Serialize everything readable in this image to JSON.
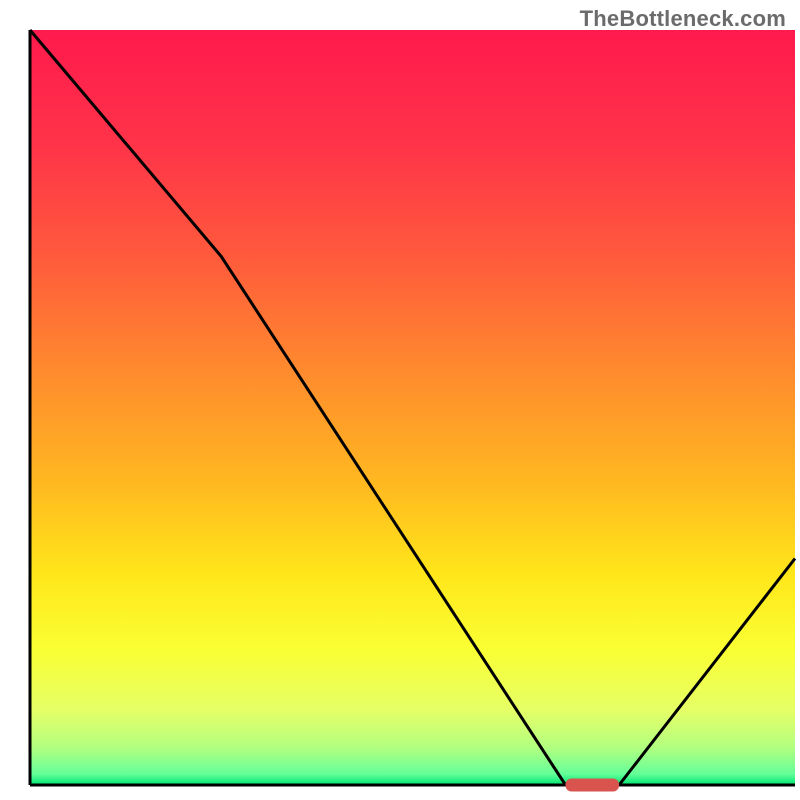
{
  "watermark": "TheBottleneck.com",
  "colors": {
    "stroke": "#000000",
    "marker_fill": "#d9534f",
    "gradient_stops": [
      {
        "offset": 0.0,
        "color": "#ff1a4d"
      },
      {
        "offset": 0.15,
        "color": "#ff3349"
      },
      {
        "offset": 0.3,
        "color": "#ff5a3c"
      },
      {
        "offset": 0.45,
        "color": "#ff8a2e"
      },
      {
        "offset": 0.6,
        "color": "#ffb820"
      },
      {
        "offset": 0.72,
        "color": "#ffe61a"
      },
      {
        "offset": 0.82,
        "color": "#faff33"
      },
      {
        "offset": 0.9,
        "color": "#e6ff66"
      },
      {
        "offset": 0.95,
        "color": "#b3ff80"
      },
      {
        "offset": 0.985,
        "color": "#66ff99"
      },
      {
        "offset": 1.0,
        "color": "#00e673"
      }
    ]
  },
  "chart_data": {
    "type": "line",
    "title": "",
    "xlabel": "",
    "ylabel": "",
    "xlim": [
      0,
      100
    ],
    "ylim": [
      0,
      100
    ],
    "x": [
      0,
      25,
      70,
      77,
      100
    ],
    "values": [
      100,
      70,
      0,
      0,
      30
    ],
    "marker": {
      "x_start": 70,
      "x_end": 77,
      "y": 0
    },
    "annotations": []
  }
}
